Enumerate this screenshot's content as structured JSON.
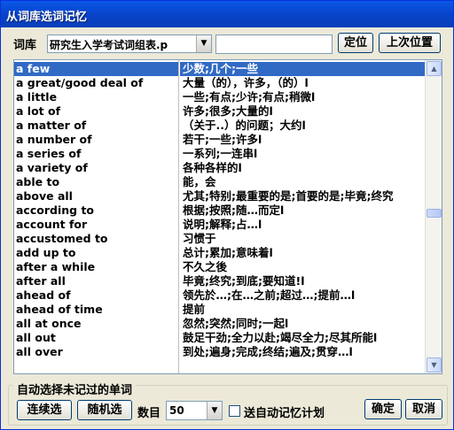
{
  "window": {
    "title": "从词库选词记忆"
  },
  "toolbar": {
    "lexicon_label": "词库",
    "lexicon_value": "研究生入学考试词组表.p",
    "search_value": "",
    "locate_label": "定位",
    "last_position_label": "上次位置"
  },
  "entries": [
    {
      "phrase": "a few",
      "meaning": "少数;几个;一些"
    },
    {
      "phrase": "a great/good deal of",
      "meaning": "大量（的），许多，（的）l"
    },
    {
      "phrase": "a little",
      "meaning": "一些;有点;少许;有点;稍微l"
    },
    {
      "phrase": "a lot of",
      "meaning": "许多;很多;大量的l"
    },
    {
      "phrase": "a matter of",
      "meaning": "（关于..）的问题；大约l"
    },
    {
      "phrase": "a number of",
      "meaning": "若干;一些;许多l"
    },
    {
      "phrase": "a series of",
      "meaning": "一系列;一连串l"
    },
    {
      "phrase": "a variety of",
      "meaning": "各种各样的l"
    },
    {
      "phrase": "able to",
      "meaning": "能，会"
    },
    {
      "phrase": "above all",
      "meaning": "尤其;特别;最重要的是;首要的是;毕竟;终究"
    },
    {
      "phrase": "according to",
      "meaning": "根据;按照;随…而定l"
    },
    {
      "phrase": "account for",
      "meaning": "说明;解释;占…l"
    },
    {
      "phrase": "accustomed to",
      "meaning": "习惯于"
    },
    {
      "phrase": "add up to",
      "meaning": "总计;累加;意味着l"
    },
    {
      "phrase": "after a while",
      "meaning": "不久之後"
    },
    {
      "phrase": "after all",
      "meaning": "毕竟;终究;到底;要知道!l"
    },
    {
      "phrase": "ahead of",
      "meaning": "领先於…;在…之前;超过…;提前…l"
    },
    {
      "phrase": "ahead of time",
      "meaning": "提前"
    },
    {
      "phrase": "all at once",
      "meaning": "忽然;突然;同时;一起l"
    },
    {
      "phrase": "all out",
      "meaning": "鼓足干劲;全力以赴;竭尽全力;尽其所能l"
    },
    {
      "phrase": "all over",
      "meaning": "到处;遍身;完成;终结;遍及;贯穿…l"
    }
  ],
  "options": {
    "legend": "自动选择未记过的单词",
    "sequential_label": "连续选",
    "random_label": "随机选",
    "count_label": "数目",
    "count_value": "50",
    "auto_memory_label": "送自动记忆计划",
    "auto_memory_checked": false
  },
  "footer": {
    "ok_label": "确定",
    "cancel_label": "取消"
  }
}
